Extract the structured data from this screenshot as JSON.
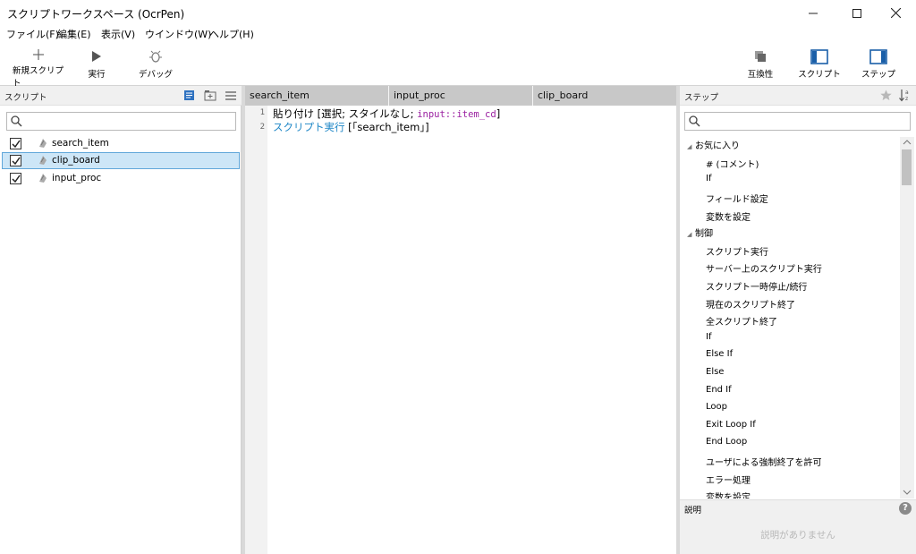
{
  "window": {
    "title": "スクリプトワークスペース (OcrPen)"
  },
  "menu": [
    "ファイル(F)",
    "編集(E)",
    "表示(V)",
    "ウインドウ(W)",
    "ヘルプ(H)"
  ],
  "toolbar": {
    "left": [
      {
        "label": "新規スクリプト",
        "icon": "plus-icon"
      },
      {
        "label": "実行",
        "icon": "play-icon"
      },
      {
        "label": "デバッグ",
        "icon": "bug-icon"
      }
    ],
    "right": [
      {
        "label": "互換性",
        "icon": "compatibility-icon"
      },
      {
        "label": "スクリプト",
        "icon": "left-pane-icon"
      },
      {
        "label": "ステップ",
        "icon": "right-pane-icon"
      }
    ]
  },
  "scripts_panel": {
    "header": "スクリプト",
    "search_placeholder": "",
    "items": [
      {
        "label": "search_item",
        "checked": true,
        "selected": false
      },
      {
        "label": "clip_board",
        "checked": true,
        "selected": true
      },
      {
        "label": "input_proc",
        "checked": true,
        "selected": false
      }
    ]
  },
  "editor": {
    "tabs": [
      "search_item",
      "input_proc",
      "clip_board"
    ],
    "lines": [
      {
        "num": "1",
        "a": "貼り付け [選択; スタイルなし; ",
        "b": "input::item_cd",
        "c": "]"
      },
      {
        "num": "2",
        "a": "スクリプト実行",
        "b": " [「search_item」]"
      }
    ]
  },
  "steps_panel": {
    "header": "ステップ",
    "search_placeholder": "",
    "categories": [
      {
        "label": "お気に入り",
        "items": [
          "# (コメント)",
          "If",
          "フィールド設定",
          "変数を設定"
        ]
      },
      {
        "label": "制御",
        "items": [
          "スクリプト実行",
          "サーバー上のスクリプト実行",
          "スクリプト一時停止/続行",
          "現在のスクリプト終了",
          "全スクリプト終了",
          "If",
          "Else If",
          "Else",
          "End If",
          "Loop",
          "Exit Loop If",
          "End Loop",
          "ユーザによる強制終了を許可",
          "エラー処理",
          "変数を設定"
        ]
      }
    ],
    "description_header": "説明",
    "description_empty": "説明がありません"
  }
}
